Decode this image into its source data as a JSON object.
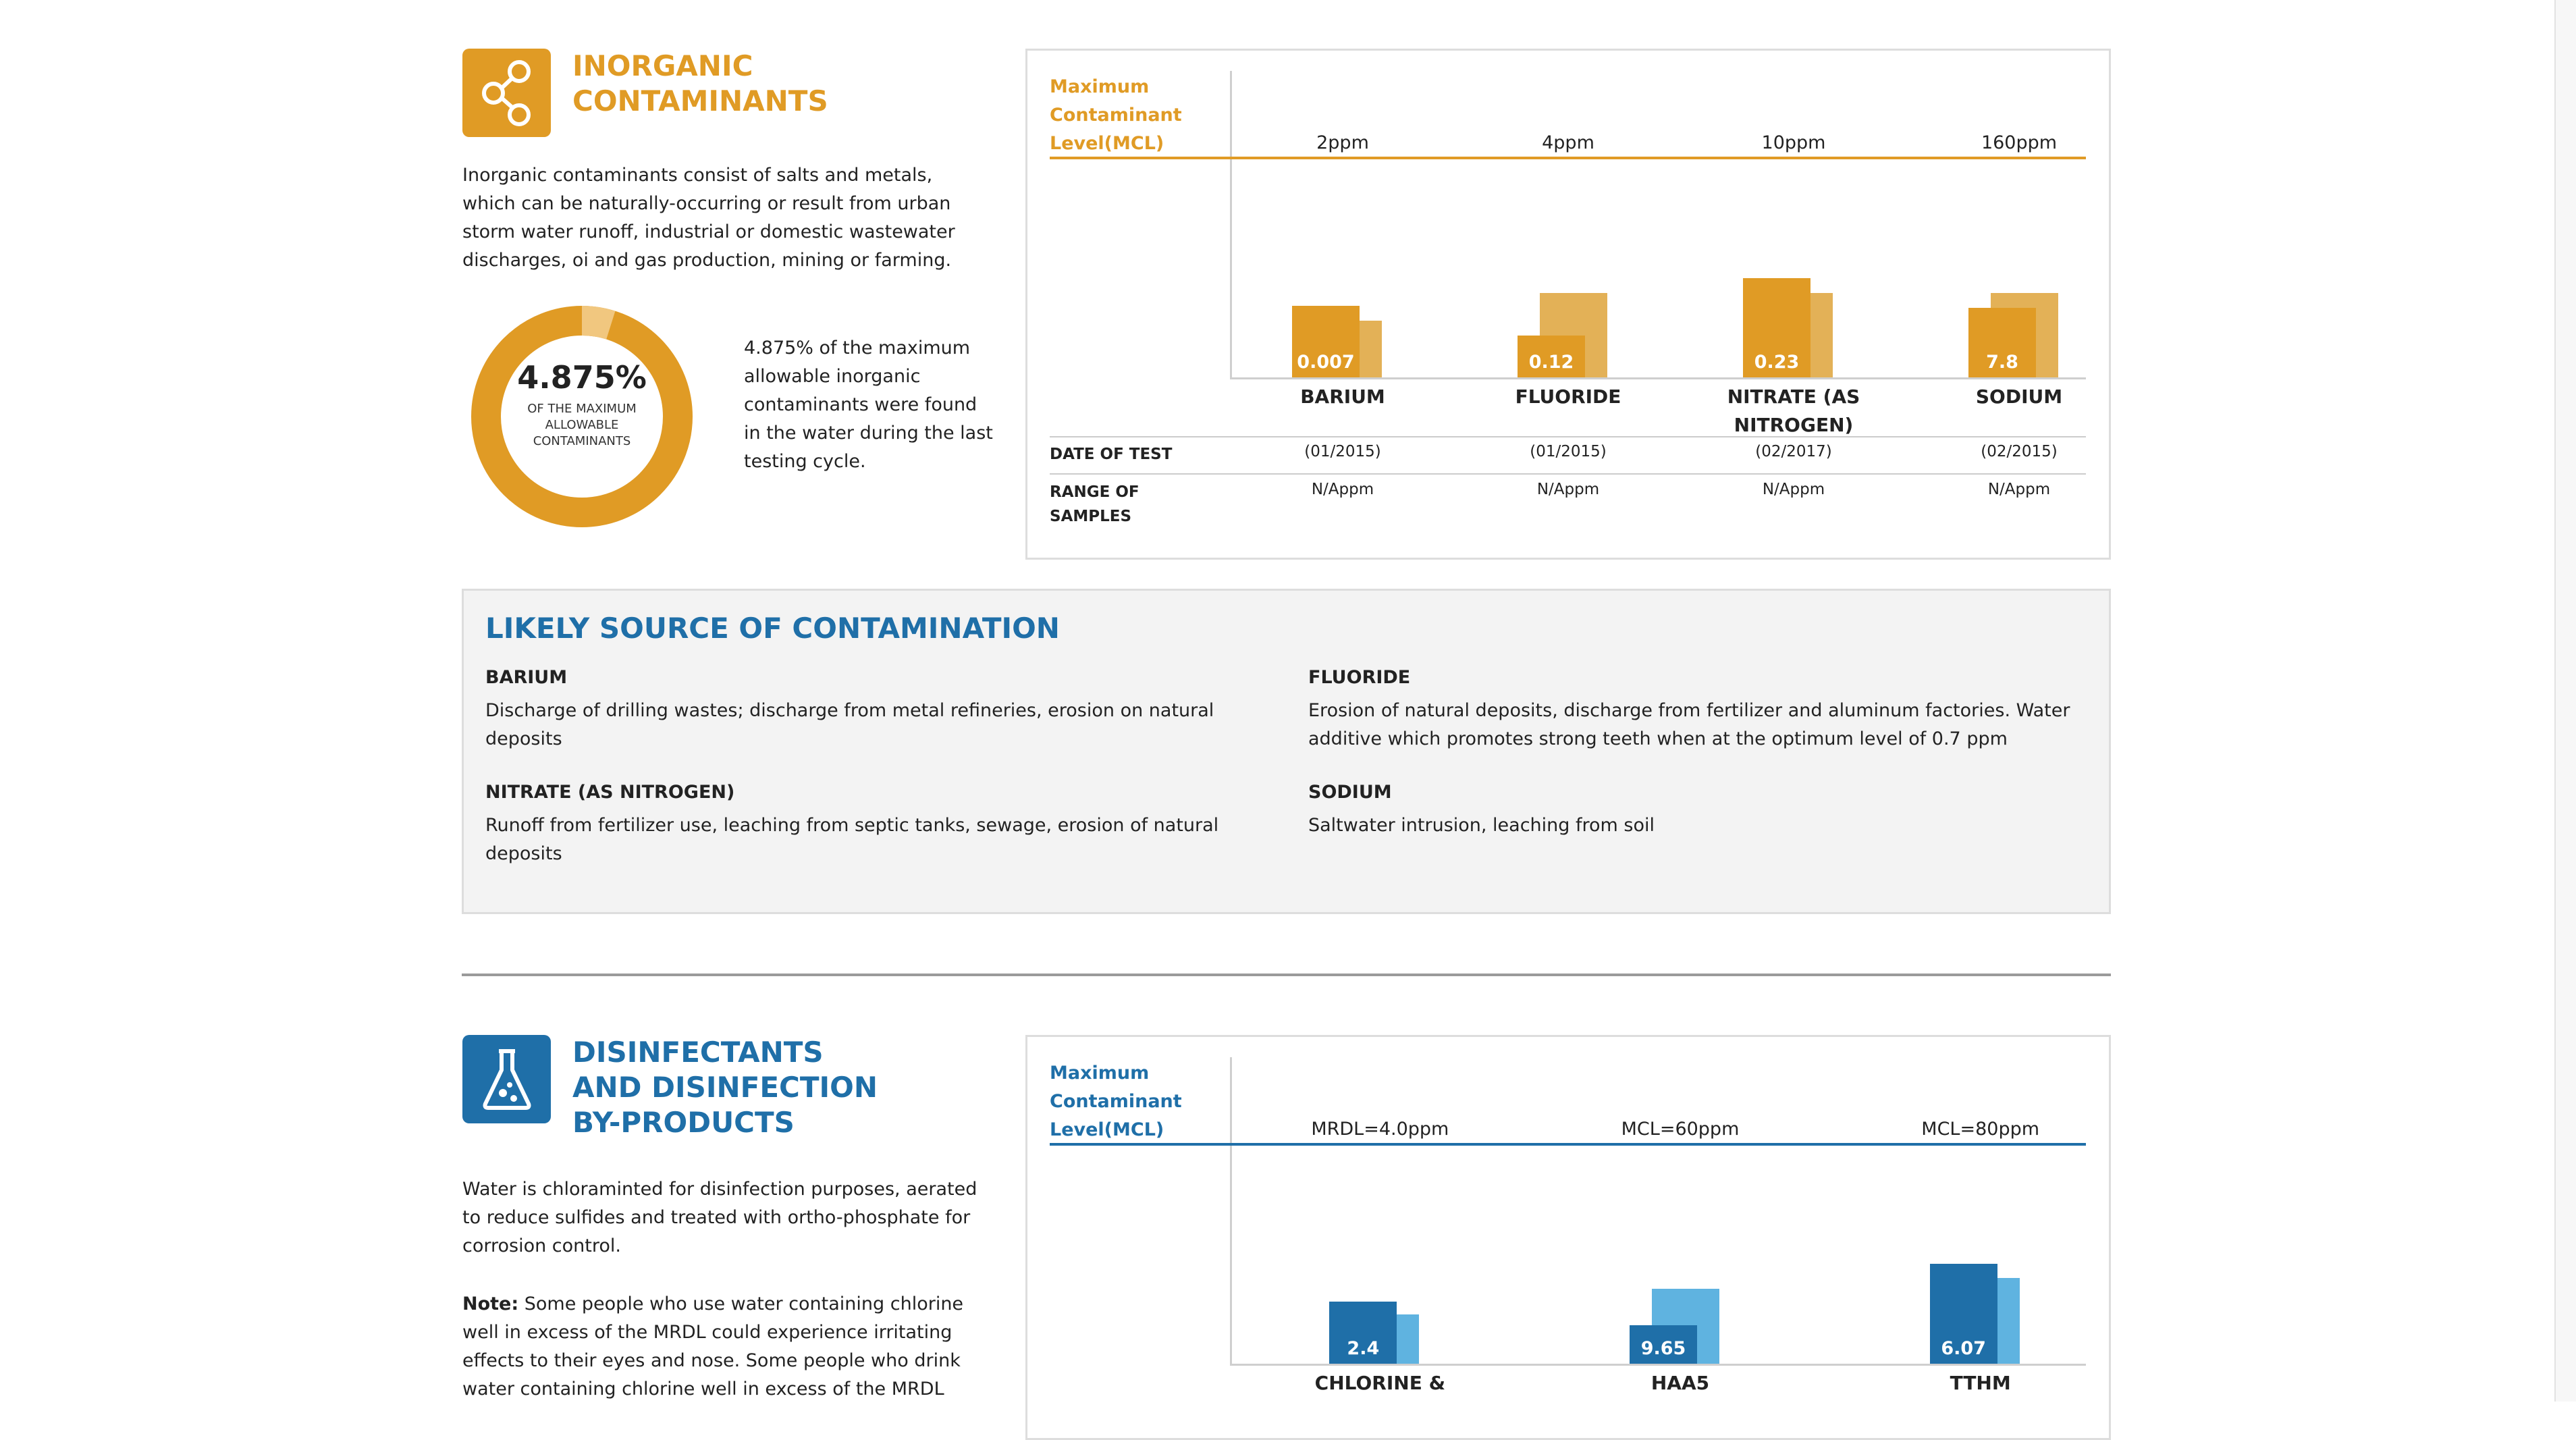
{
  "colors": {
    "amber": "#e09b25",
    "amber_light": "#e3b157",
    "blue": "#1f6fa8",
    "blue_light": "#5fb3e0"
  },
  "inorganic": {
    "icon": "share-nodes-icon",
    "title": "INORGANIC CONTAMINANTS",
    "description": "Inorganic contaminants consist of salts and metals, which can be naturally-occurring or result from urban storm water runoff, industrial or domestic wastewater discharges, oi and gas production, mining or farming.",
    "donut": {
      "percent_label": "4.875%",
      "caption": "OF THE MAXIMUM ALLOWABLE CONTAMINANTS",
      "fraction": 0.04875,
      "note": "4.875% of the maximum allowable inorganic contaminants were found in the water during the last testing cycle."
    },
    "mcl_label": "Maximum Contaminant Level(MCL)",
    "date_label": "DATE OF TEST",
    "range_label": "RANGE OF SAMPLES"
  },
  "sources": {
    "title": "LIKELY SOURCE OF CONTAMINATION",
    "items": [
      {
        "name": "BARIUM",
        "text": "Discharge of drilling wastes; discharge from metal refineries, erosion on natural deposits"
      },
      {
        "name": "FLUORIDE",
        "text": "Erosion of natural deposits, discharge from fertilizer and aluminum factories. Water additive which promotes strong teeth when at the optimum level of 0.7 ppm"
      },
      {
        "name": "NITRATE (AS NITROGEN)",
        "text": "Runoff from fertilizer use, leaching from septic tanks, sewage, erosion of natural deposits"
      },
      {
        "name": "SODIUM",
        "text": "Saltwater intrusion, leaching from soil"
      }
    ]
  },
  "disinfectants": {
    "icon": "flask-icon",
    "title": "DISINFECTANTS AND DISINFECTION BY-PRODUCTS",
    "description": "Water is chloraminted for disinfection purposes, aerated to reduce sulfides and treated with ortho-phosphate for corrosion control.",
    "note_label": "Note:",
    "note_text": " Some people who use water containing chlorine well in excess of the MRDL could experience irritating effects to their eyes and nose. Some people who drink water containing chlorine well in excess of the MRDL",
    "mcl_label": "Maximum Contaminant Level(MCL)"
  },
  "chart_data": [
    {
      "type": "bar",
      "categories": [
        "BARIUM",
        "FLUORIDE",
        "NITRATE (AS NITROGEN)",
        "SODIUM"
      ],
      "limits": [
        "2ppm",
        "4ppm",
        "10ppm",
        "160ppm"
      ],
      "series": [
        {
          "values": [
            0.007,
            0.12,
            0.23,
            7.8
          ],
          "labels": [
            "0.007",
            "0.12",
            "0.23",
            "7.8"
          ],
          "relative": [
            0.48,
            0.28,
            0.67,
            0.47
          ]
        },
        {
          "relative": [
            0.38,
            0.57,
            0.57,
            0.57
          ]
        }
      ],
      "dates": [
        "(01/2015)",
        "(01/2015)",
        "(02/2017)",
        "(02/2015)"
      ],
      "ranges": [
        "N/Appm",
        "N/Appm",
        "N/Appm",
        "N/Appm"
      ]
    },
    {
      "type": "bar",
      "categories": [
        "CHLORINE &",
        "HAA5",
        "TTHM"
      ],
      "limits": [
        "MRDL=4.0ppm",
        "MCL=60ppm",
        "MCL=80ppm"
      ],
      "series": [
        {
          "values": [
            2.4,
            9.65,
            6.07
          ],
          "labels": [
            "2.4",
            "9.65",
            "6.07"
          ],
          "relative": [
            0.34,
            0.21,
            0.55
          ]
        },
        {
          "relative": [
            0.27,
            0.41,
            0.47
          ]
        }
      ]
    }
  ]
}
